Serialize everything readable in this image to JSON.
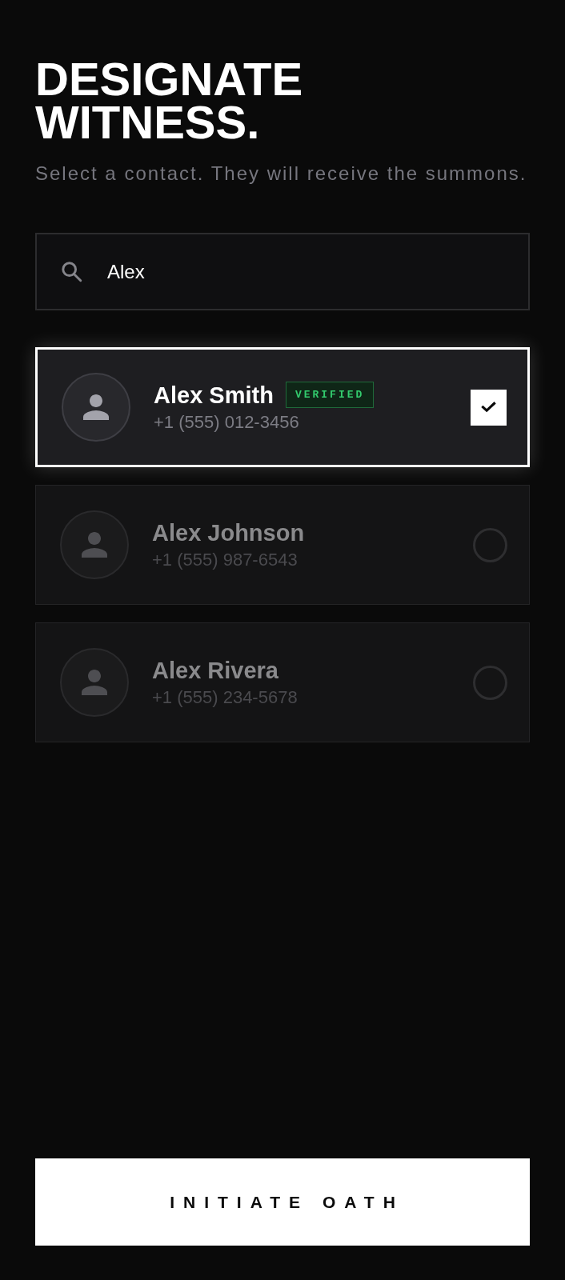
{
  "header": {
    "title": "DESIGNATE WITNESS.",
    "subtitle": "Select a contact. They will receive the summons."
  },
  "search": {
    "value": "Alex"
  },
  "contacts": [
    {
      "name": "Alex Smith",
      "phone": "+1 (555) 012-3456",
      "badge": "VERIFIED",
      "selected": true
    },
    {
      "name": "Alex Johnson",
      "phone": "+1 (555) 987-6543",
      "selected": false
    },
    {
      "name": "Alex Rivera",
      "phone": "+1 (555) 234-5678",
      "selected": false
    }
  ],
  "primary_button": {
    "label": "INITIATE OATH"
  }
}
